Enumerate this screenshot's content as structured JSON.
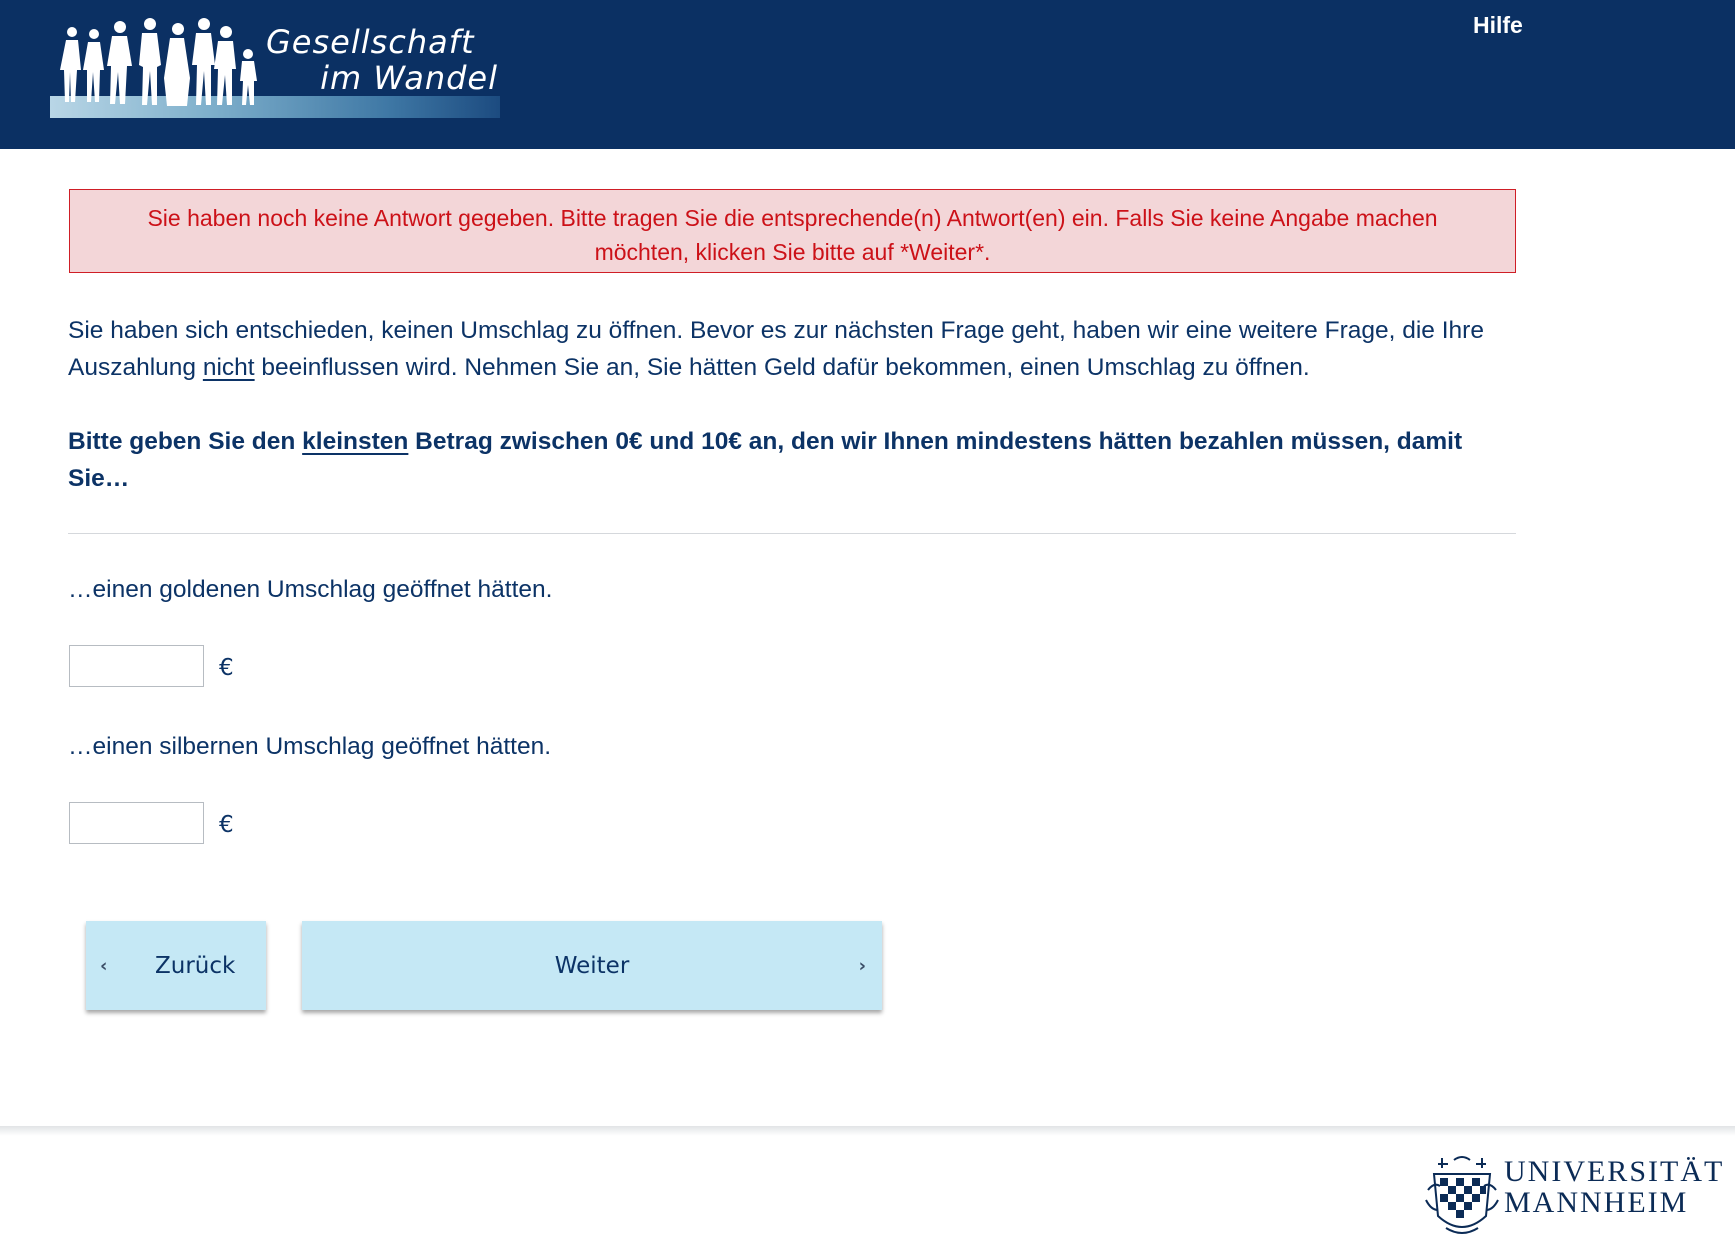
{
  "header": {
    "logo_line1": "Gesellschaft",
    "logo_line2": "im Wandel",
    "help_label": "Hilfe"
  },
  "error": {
    "message": "Sie haben noch keine Antwort gegeben. Bitte tragen Sie die entsprechende(n) Antwort(en) ein. Falls Sie keine Angabe machen möchten, klicken Sie bitte auf *Weiter*."
  },
  "intro": {
    "part1": "Sie haben sich entschieden, keinen Umschlag zu öffnen. Bevor es zur nächsten Frage geht, haben wir eine weitere Frage, die Ihre Auszahlung ",
    "emphasis": "nicht",
    "part2": " beeinflussen wird. Nehmen Sie an, Sie hätten Geld dafür bekommen, einen Umschlag zu öffnen."
  },
  "question": {
    "part1": "Bitte geben Sie den ",
    "emphasis": "kleinsten",
    "part2": " Betrag zwischen 0€ und 10€ an, den wir Ihnen mindestens hätten bezahlen müssen, damit Sie…"
  },
  "items": [
    {
      "label": "…einen goldenen Umschlag geöffnet hätten.",
      "value": "",
      "unit": "€"
    },
    {
      "label": "…einen silbernen Umschlag geöffnet hätten.",
      "value": "",
      "unit": "€"
    }
  ],
  "buttons": {
    "back_label": "Zurück",
    "next_label": "Weiter"
  },
  "footer": {
    "uni_line1": "UNIVERSITÄT",
    "uni_line2": "MANNHEIM"
  },
  "icons": {
    "back": "chevron-left-icon",
    "next": "chevron-right-icon"
  },
  "colors": {
    "header_bg": "#0b3063",
    "text": "#0c3366",
    "error_text": "#cc1118",
    "error_bg": "#f3d6d8",
    "button_bg": "#c5e8f5"
  }
}
